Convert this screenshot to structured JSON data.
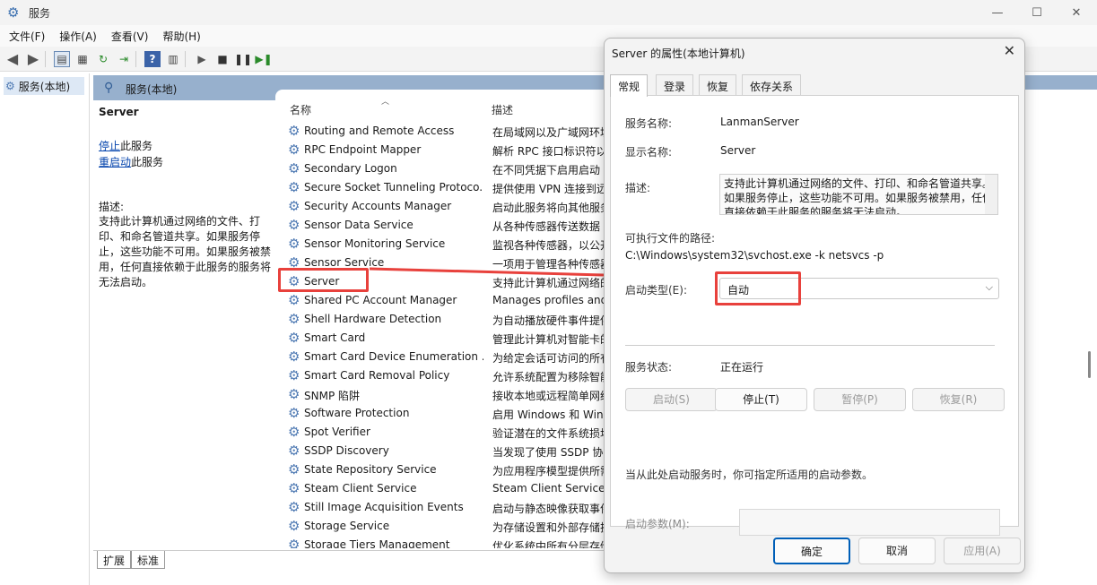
{
  "window": {
    "title": "服务"
  },
  "menu": [
    "文件(F)",
    "操作(A)",
    "查看(V)",
    "帮助(H)"
  ],
  "tree": {
    "root": "服务(本地)"
  },
  "header": {
    "title": "服务(本地)"
  },
  "details": {
    "service_name": "Server",
    "stop_link": "停止",
    "stop_suffix": "此服务",
    "restart_link": "重启动",
    "restart_suffix": "此服务",
    "desc_label": "描述:",
    "desc_text": "支持此计算机通过网络的文件、打印、和命名管道共享。如果服务停止，这些功能不可用。如果服务被禁用，任何直接依赖于此服务的服务将无法启动。"
  },
  "list": {
    "col_name": "名称",
    "col_desc": "描述",
    "rows": [
      {
        "name": "Routing and Remote Access",
        "desc": "在局域网以及广域网环境"
      },
      {
        "name": "RPC Endpoint Mapper",
        "desc": "解析 RPC 接口标识符以"
      },
      {
        "name": "Secondary Logon",
        "desc": "在不同凭据下启用启动"
      },
      {
        "name": "Secure Socket Tunneling Protoco...",
        "desc": "提供使用 VPN 连接到远"
      },
      {
        "name": "Security Accounts Manager",
        "desc": "启动此服务将向其他服务"
      },
      {
        "name": "Sensor Data Service",
        "desc": "从各种传感器传送数据"
      },
      {
        "name": "Sensor Monitoring Service",
        "desc": "监视各种传感器，以公开"
      },
      {
        "name": "Sensor Service",
        "desc": "一项用于管理各种传感器"
      },
      {
        "name": "Server",
        "desc": "支持此计算机通过网络的"
      },
      {
        "name": "Shared PC Account Manager",
        "desc": "Manages profiles and"
      },
      {
        "name": "Shell Hardware Detection",
        "desc": "为自动播放硬件事件提供"
      },
      {
        "name": "Smart Card",
        "desc": "管理此计算机对智能卡的"
      },
      {
        "name": "Smart Card Device Enumeration ...",
        "desc": "为给定会话可访问的所有"
      },
      {
        "name": "Smart Card Removal Policy",
        "desc": "允许系统配置为移除智能"
      },
      {
        "name": "SNMP 陷阱",
        "desc": "接收本地或远程简单网络"
      },
      {
        "name": "Software Protection",
        "desc": "启用 Windows 和 Win"
      },
      {
        "name": "Spot Verifier",
        "desc": "验证潜在的文件系统损坏"
      },
      {
        "name": "SSDP Discovery",
        "desc": "当发现了使用 SSDP 协"
      },
      {
        "name": "State Repository Service",
        "desc": "为应用程序模型提供所需"
      },
      {
        "name": "Steam Client Service",
        "desc": "Steam Client Service"
      },
      {
        "name": "Still Image Acquisition Events",
        "desc": "启动与静态映像获取事件"
      },
      {
        "name": "Storage Service",
        "desc": "为存储设置和外部存储扩"
      },
      {
        "name": "Storage Tiers Management",
        "desc": "优化系统中所有分层存储"
      }
    ]
  },
  "bottom_tabs": [
    "扩展",
    "标准"
  ],
  "dialog": {
    "title": "Server 的属性(本地计算机)",
    "tabs": [
      "常规",
      "登录",
      "恢复",
      "依存关系"
    ],
    "service_name_label": "服务名称:",
    "service_name_value": "LanmanServer",
    "display_name_label": "显示名称:",
    "display_name_value": "Server",
    "desc_label": "描述:",
    "desc_value": "支持此计算机通过网络的文件、打印、和命名管道共享。如果服务停止，这些功能不可用。如果服务被禁用，任何直接依赖于此服务的服务将无法启动。",
    "path_label": "可执行文件的路径:",
    "path_value": "C:\\Windows\\system32\\svchost.exe -k netsvcs -p",
    "startup_label": "启动类型(E):",
    "startup_value": "自动",
    "status_label": "服务状态:",
    "status_value": "正在运行",
    "btn_start": "启动(S)",
    "btn_stop": "停止(T)",
    "btn_pause": "暂停(P)",
    "btn_resume": "恢复(R)",
    "hint": "当从此处启动服务时，你可指定所适用的启动参数。",
    "param_label": "启动参数(M):",
    "ok": "确定",
    "cancel": "取消",
    "apply": "应用(A)"
  },
  "colors": {
    "highlight": "#e8413c",
    "header": "#97b0cd",
    "link": "#0645ad",
    "primary": "#005fb8"
  }
}
